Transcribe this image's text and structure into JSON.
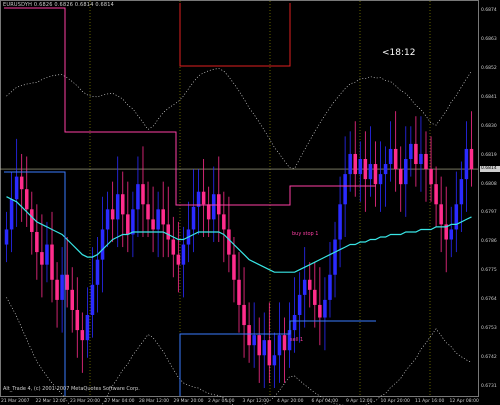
{
  "window": {
    "header": "EURUSDYH 0.6826 0.6826 0.6814 0.6814",
    "footer": "Alt_Trade 4, (c) 2001-2007 MetaQuotes Software Corp.",
    "countdown": "<18:12"
  },
  "colors": {
    "background": "#000000",
    "axis": "#c9c9c9",
    "grid_vertical": "#c8c800",
    "bull_candle": "#2b2bff",
    "bear_candle": "#ff2d8c",
    "ma_line": "#39e6e6",
    "channel_line": "#ff3fa5",
    "level_blue": "#3a7bff",
    "level_red": "#e02020",
    "band_dotted": "#ffffff"
  },
  "chart_data": {
    "type": "candlestick",
    "symbol": "EURUSDYH",
    "timeframe": "H1",
    "y_axis_ticks": [
      "0.6874",
      "0.6863",
      "0.6852",
      "0.6841",
      "0.6830",
      "0.6819",
      "0.6808",
      "0.6797",
      "0.6786",
      "0.6775",
      "0.6764",
      "0.6753",
      "0.6742",
      "0.6731"
    ],
    "x_axis_ticks": [
      "21 Mar 2007",
      "22 Mar 12:00",
      "23 Mar 20:00",
      "27 Mar 04:00",
      "28 Mar 12:00",
      "29 Mar 20:00",
      "2 Apr 04:00",
      "3 Apr 12:00",
      "4 Apr 20:00",
      "6 Apr 04:00",
      "9 Apr 12:00",
      "10 Apr 20:00",
      "11 Apr 16:00",
      "12 Apr 08:00"
    ],
    "current_price": "0.6814",
    "ylim": [
      0.6725,
      0.688
    ],
    "closes": [
      0.679,
      0.6802,
      0.6811,
      0.6806,
      0.6798,
      0.6789,
      0.6781,
      0.6776,
      0.6784,
      0.677,
      0.6762,
      0.6772,
      0.6766,
      0.6758,
      0.675,
      0.6746,
      0.6756,
      0.6768,
      0.6778,
      0.679,
      0.6798,
      0.6794,
      0.6804,
      0.6796,
      0.6788,
      0.6798,
      0.6808,
      0.68,
      0.6794,
      0.679,
      0.6798,
      0.6792,
      0.6786,
      0.678,
      0.6776,
      0.6784,
      0.679,
      0.6799,
      0.6805,
      0.68,
      0.6794,
      0.6804,
      0.6796,
      0.679,
      0.678,
      0.677,
      0.676,
      0.6752,
      0.6744,
      0.6748,
      0.674,
      0.6746,
      0.6736,
      0.674,
      0.6748,
      0.6742,
      0.675,
      0.6756,
      0.6764,
      0.677,
      0.6766,
      0.676,
      0.6755,
      0.6762,
      0.6772,
      0.6786,
      0.68,
      0.6812,
      0.682,
      0.6812,
      0.6818,
      0.681,
      0.6816,
      0.6808,
      0.6812,
      0.6816,
      0.6822,
      0.6814,
      0.6808,
      0.6818,
      0.6824,
      0.6816,
      0.682,
      0.6814,
      0.6808,
      0.68,
      0.6792,
      0.6786,
      0.679,
      0.68,
      0.681,
      0.6822,
      0.6814
    ],
    "ma_line": [
      0.6803,
      0.6802,
      0.6801,
      0.6799,
      0.6797,
      0.6795,
      0.6793,
      0.6792,
      0.6791,
      0.679,
      0.6789,
      0.6788,
      0.6786,
      0.6784,
      0.6782,
      0.678,
      0.6779,
      0.6779,
      0.678,
      0.6782,
      0.6784,
      0.6786,
      0.6787,
      0.6788,
      0.6788,
      0.6789,
      0.6789,
      0.6789,
      0.6789,
      0.6789,
      0.6789,
      0.6789,
      0.6788,
      0.6787,
      0.6786,
      0.6786,
      0.6787,
      0.6788,
      0.6789,
      0.6789,
      0.6789,
      0.6789,
      0.6789,
      0.6788,
      0.6786,
      0.6784,
      0.6782,
      0.678,
      0.6778,
      0.6777,
      0.6776,
      0.6775,
      0.6774,
      0.6773,
      0.6773,
      0.6773,
      0.6773,
      0.6773,
      0.6774,
      0.6775,
      0.6776,
      0.6777,
      0.6778,
      0.6779,
      0.678,
      0.6781,
      0.6782,
      0.6783,
      0.6784,
      0.6784,
      0.6785,
      0.6785,
      0.6786,
      0.6786,
      0.6787,
      0.6787,
      0.6788,
      0.6788,
      0.6788,
      0.6789,
      0.6789,
      0.6789,
      0.679,
      0.679,
      0.679,
      0.6791,
      0.6791,
      0.6791,
      0.6792,
      0.6792,
      0.6793,
      0.6794,
      0.6795
    ],
    "price_markers": [
      {
        "text": "sell 1",
        "value": 0.6746
      },
      {
        "text": "buy stop 1",
        "value": 0.6788
      }
    ]
  }
}
